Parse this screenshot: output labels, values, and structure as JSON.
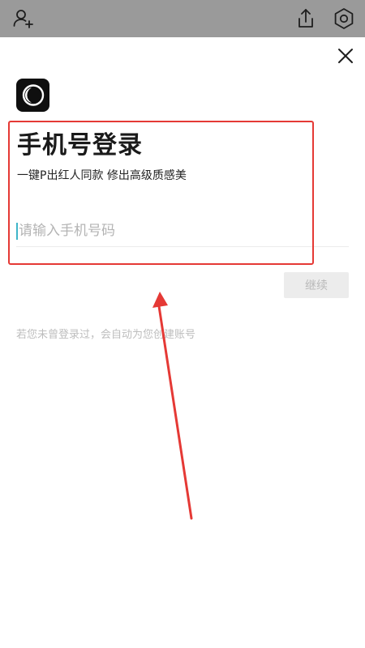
{
  "header": {
    "add_user_icon": "add-user-icon",
    "share_icon": "share-icon",
    "settings_icon": "settings-icon",
    "bar_color": "#9a9a9a"
  },
  "close_icon": "close-icon",
  "logo": {
    "icon": "app-logo-icon",
    "color": "#0f0f0f"
  },
  "login": {
    "title": "手机号登录",
    "subtitle": "一键P出红人同款 修出高级质感美",
    "phone_placeholder": "请输入手机号码",
    "phone_value": "",
    "continue_label": "继续",
    "hint": "若您未曾登录过，会自动为您创建账号"
  },
  "annotation": {
    "box_color": "#e53935",
    "arrow_color": "#e53935"
  }
}
